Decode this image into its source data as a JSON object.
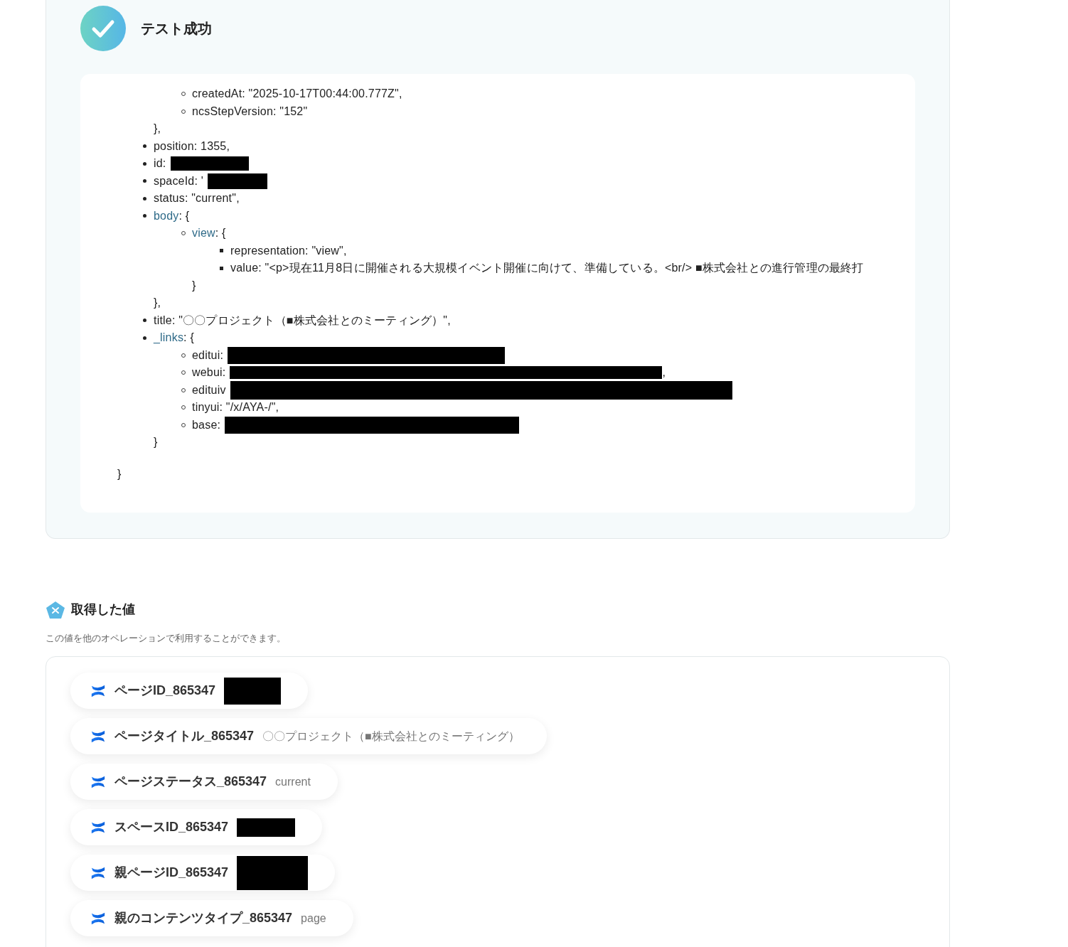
{
  "result": {
    "title": "テスト成功",
    "tree": [
      {
        "children": [
          {
            "text": "createdAt: \"2025-10-17T00:44:00.777Z\","
          },
          {
            "text": "ncsStepVersion: \"152\""
          }
        ],
        "close": "},"
      },
      {
        "text": "position: 1355,"
      },
      {
        "text": "id:",
        "redacted": true
      },
      {
        "text": "spaceId: '",
        "redacted": true
      },
      {
        "text": "status: \"current\","
      },
      {
        "key": "body",
        "text": ": {",
        "link": true,
        "children": [
          {
            "key": "view",
            "text": ": {",
            "link": true,
            "children": [
              {
                "text": "representation: \"view\","
              },
              {
                "text": "value: \"<p>現在11月8日に開催される大規模イベント開催に向けて、準備している。<br/> ■株式会社との進行管理の最終打"
              }
            ],
            "close": "}"
          }
        ],
        "close": "},"
      },
      {
        "text": "title: \"〇〇プロジェクト（■株式会社とのミーティング）\","
      },
      {
        "key": "_links",
        "text": ": {",
        "link": true,
        "children": [
          {
            "text": "editui:",
            "redacted": true
          },
          {
            "text": "webui:",
            "redacted": true,
            "after": ","
          },
          {
            "text": "edituiv",
            "redacted": true
          },
          {
            "text": "tinyui: \"/x/AYA-/\","
          },
          {
            "text": "base:",
            "redacted": true
          }
        ],
        "close": "}"
      }
    ],
    "close": "}"
  },
  "values": {
    "title": "取得した値",
    "description": "この値を他のオペレーションで利用することができます。",
    "items": [
      {
        "label": "ページID_865347",
        "redacted": true
      },
      {
        "label": "ページタイトル_865347",
        "value": "〇〇プロジェクト（■株式会社とのミーティング）"
      },
      {
        "label": "ページステータス_865347",
        "value": "current"
      },
      {
        "label": "スペースID_865347",
        "redacted": true
      },
      {
        "label": "親ページID_865347",
        "redacted": true
      },
      {
        "label": "親のコンテンツタイプ_865347",
        "value": "page"
      }
    ]
  }
}
